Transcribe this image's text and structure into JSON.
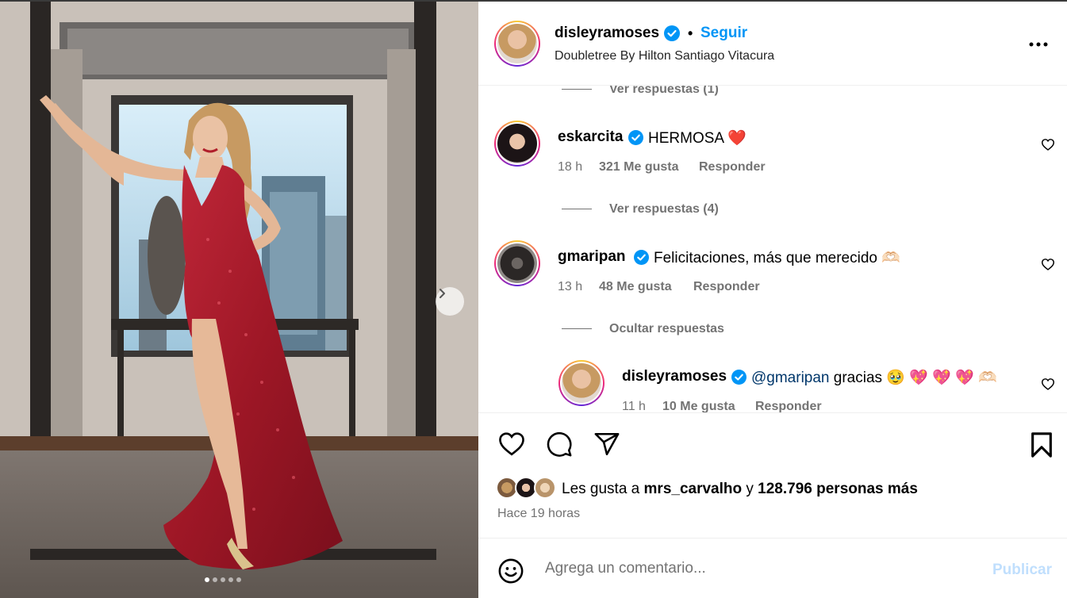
{
  "post": {
    "author": "disleyramoses",
    "follow_label": "Seguir",
    "separator": "•",
    "location": "Doubletree By Hilton Santiago Vitacura"
  },
  "comments": {
    "prev_replies": "Ver respuestas (1)",
    "items": [
      {
        "user": "eskarcita",
        "text": "HERMOSA",
        "emoji": "❤️",
        "time": "18 h",
        "likes": "321 Me gusta",
        "reply": "Responder",
        "replies_label": "Ver respuestas (4)"
      },
      {
        "user": "gmaripan",
        "text": "Felicitaciones, más que merecido",
        "emoji": "🫶🏻",
        "time": "13 h",
        "likes": "48 Me gusta",
        "reply": "Responder",
        "replies_label": "Ocultar respuestas"
      }
    ],
    "reply_item": {
      "user": "disleyramoses",
      "mention": "@gmaripan",
      "text": "gracias",
      "emojis": "🥹 💖 💖 💖 🫶🏻",
      "time": "11 h",
      "likes": "10 Me gusta",
      "reply": "Responder"
    }
  },
  "likes": {
    "prefix": "Les gusta a",
    "first_user": "mrs_carvalho",
    "conj": "y",
    "count_text": "128.796 personas más",
    "time_ago": "Hace 19 horas"
  },
  "composer": {
    "placeholder": "Agrega un comentario...",
    "publish_label": "Publicar"
  },
  "carousel": {
    "total_slides": 5,
    "current_slide": 1
  },
  "colors": {
    "accent": "#0095f6",
    "muted": "#737373",
    "dress": "#a81c2a",
    "publish_disabled": "#c0dffd"
  }
}
